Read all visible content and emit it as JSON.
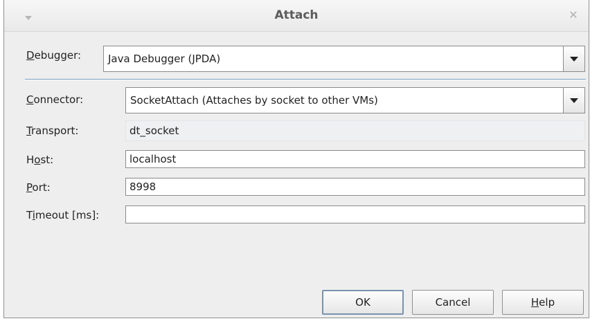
{
  "window": {
    "title": "Attach"
  },
  "debugger": {
    "label_mnemonic": "D",
    "label_rest": "ebugger:",
    "selected": "Java Debugger (JPDA)"
  },
  "connector": {
    "label_mnemonic": "C",
    "label_rest": "onnector:",
    "selected": "SocketAttach (Attaches by socket to other VMs)"
  },
  "transport": {
    "label_mnemonic": "T",
    "label_rest": "ransport:",
    "value": "dt_socket"
  },
  "host": {
    "label_pre": "H",
    "label_mnemonic": "o",
    "label_rest": "st:",
    "value": "localhost"
  },
  "port": {
    "label_mnemonic": "P",
    "label_rest": "ort:",
    "value": "8998"
  },
  "timeout": {
    "label_pre": "T",
    "label_mnemonic": "i",
    "label_rest": "meout [ms]:",
    "value": ""
  },
  "buttons": {
    "ok": "OK",
    "cancel": "Cancel",
    "help_mnemonic": "H",
    "help_rest": "elp"
  },
  "icons": {
    "menu": "chevron-down-icon",
    "close": "close-icon",
    "dropdown": "dropdown-arrow-icon"
  },
  "colors": {
    "separator": "#7a9cc0",
    "default_button_border": "#7892b0"
  }
}
